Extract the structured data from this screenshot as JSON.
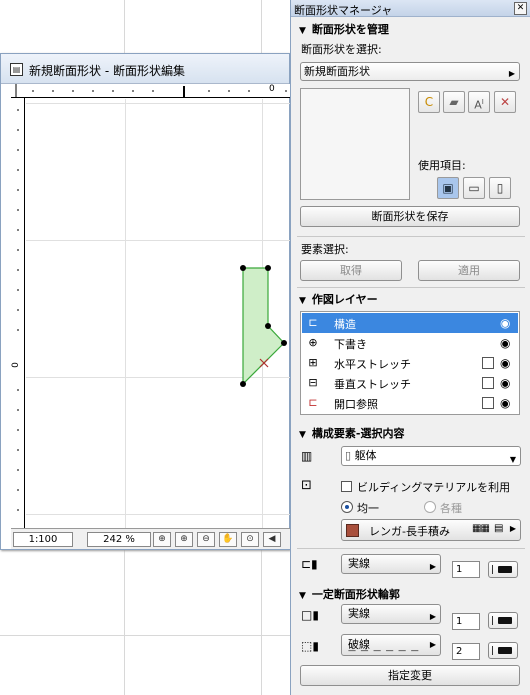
{
  "editor": {
    "title": "新規断面形状 - 断面形状編集",
    "ruler_zero": "0",
    "scale": "1:100",
    "zoom": "242 %",
    "icons": [
      "zoom-in-icon",
      "zoom-in-icon",
      "zoom-out-icon",
      "pan-hand-icon",
      "fit-zoom-icon",
      "back-zoom-icon"
    ]
  },
  "palette": {
    "title": "断面形状マネージャ",
    "manage_section": "断面形状を管理",
    "select_label": "断面形状を選択:",
    "selected_profile": "新規断面形状",
    "usage_label": "使用項目:",
    "save_button": "断面形状を保存",
    "element_select_label": "要素選択:",
    "get_button": "取得",
    "apply_button": "適用",
    "layers_section": "作図レイヤー",
    "layers": [
      {
        "name": "構造",
        "icon": "structure-layer-icon",
        "checkbox": false,
        "selected": true
      },
      {
        "name": "下書き",
        "icon": "draft-layer-icon",
        "checkbox": false,
        "selected": false
      },
      {
        "name": "水平ストレッチ",
        "icon": "horizontal-stretch-icon",
        "checkbox": true,
        "selected": false
      },
      {
        "name": "垂直ストレッチ",
        "icon": "vertical-stretch-icon",
        "checkbox": true,
        "selected": false
      },
      {
        "name": "開口参照",
        "icon": "opening-reference-icon",
        "checkbox": true,
        "selected": false
      }
    ],
    "component_section": "構成要素-選択内容",
    "component_type": "躯体",
    "building_material_label": "ビルディングマテリアルを利用",
    "radio_uniform": "均一",
    "radio_various": "各種",
    "material_name": "レンガ-長手積み",
    "line_type_1": "実線",
    "pen_1": "1",
    "fixed_section": "一定断面形状輪郭",
    "line_type_2": "実線",
    "pen_2": "1",
    "line_type_3": "破線",
    "pen_3": "2",
    "modify_button": "指定変更"
  },
  "colors": {
    "selection": "#3b87e0",
    "shape_fill": "#cfeec8",
    "shape_stroke": "#3aa83a",
    "material": "#a84f3c"
  }
}
